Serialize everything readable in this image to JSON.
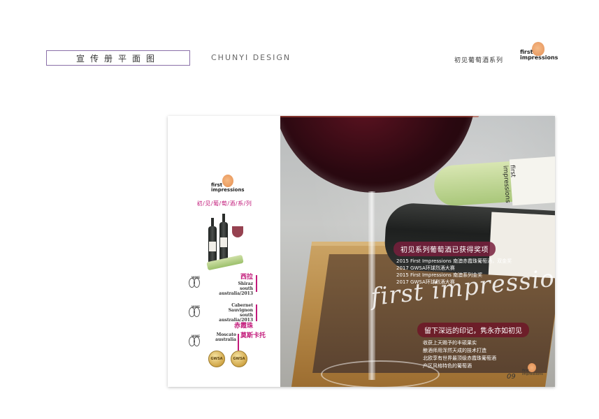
{
  "header": {
    "title": "宣传册平面图",
    "design": "CHUNYI DESIGN",
    "series_name": "初见葡萄酒系列",
    "logo_line1": "first",
    "logo_line2": "impressions"
  },
  "left_page": {
    "logo_line1": "first",
    "logo_line2": "impressions",
    "series": "初/见/葡/萄/酒/系/列",
    "wines": [
      {
        "en1": "西拉",
        "en2": "Shiraz",
        "en3": "south australia/2013",
        "cn": ""
      },
      {
        "en1": "Cabernet Sauvignon",
        "en2": "south australia/2013",
        "en3": "",
        "cn": "赤霞珠"
      },
      {
        "en1": "Moscato",
        "en2": "australia",
        "en3": "",
        "cn": "莫斯卡托"
      }
    ],
    "wine_icon_label": "WINE",
    "medal_label": "GWSA"
  },
  "right_page": {
    "award_title": "初见系列葡萄酒已获得奖项",
    "award_lines": [
      "2015  First Impressions 南澳赤霞珠葡萄酒，双金奖",
      "2017 GWSA环球烈酒大赛",
      "2015 First Impressions 南澳系列金奖",
      "2017 GWSA环球烈酒大赛"
    ],
    "script_title": "first impressions",
    "slogan": "留下深远的印记，隽永亦如初见",
    "slogan_lines": [
      "收获上天赐予的丰硕果实",
      "酿酒师用浑然天成的技术打造",
      "北欧享有世界最顶级赤霞珠葡萄酒",
      "产区风格特色的葡萄酒"
    ],
    "bottle_label": "first impressions",
    "page_number": "09",
    "logo_line1": "first",
    "logo_line2": "impressions"
  }
}
